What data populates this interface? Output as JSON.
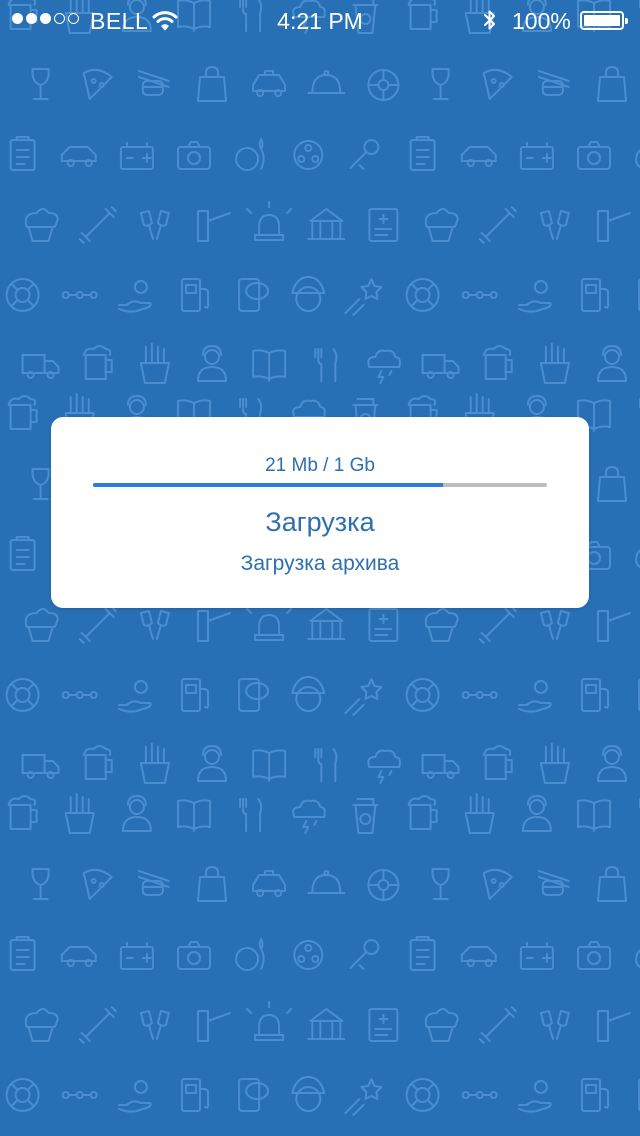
{
  "status_bar": {
    "carrier": "BELL",
    "time": "4:21 PM",
    "battery": "100%",
    "signal_bars": 3,
    "signal_total": 5
  },
  "dialog": {
    "progress_text": "21 Mb / 1 Gb",
    "progress_fraction": 0.77,
    "title": "Загрузка",
    "subtitle": "Загрузка архива"
  },
  "colors": {
    "background": "#2770b6",
    "pattern_line": "#4b8ed0",
    "accent": "#2a7ce0",
    "text": "#2e6fae"
  },
  "background_pattern_icons": [
    "beer-mug-icon",
    "french-fries-icon",
    "call-center-icon",
    "book-icon",
    "fork-knife-icon",
    "storm-cloud-icon",
    "coffee-cup-icon",
    "wine-glass-icon",
    "pizza-slice-icon",
    "sushi-icon",
    "shopping-bag-icon",
    "taxi-icon",
    "food-cloche-icon",
    "wheel-icon",
    "clipboard-icon",
    "car-icon",
    "car-battery-icon",
    "camera-icon",
    "bowling-icon",
    "film-reel-icon",
    "microphone-icon",
    "cupcake-icon",
    "dumbbell-icon",
    "toast-glasses-icon",
    "parking-barrier-icon",
    "siren-icon",
    "museum-icon",
    "medical-chart-icon",
    "lifebuoy-icon",
    "route-icon",
    "money-hand-icon",
    "gas-station-icon",
    "sos-phone-icon",
    "fireman-icon",
    "shooting-star-icon",
    "delivery-truck-icon"
  ]
}
